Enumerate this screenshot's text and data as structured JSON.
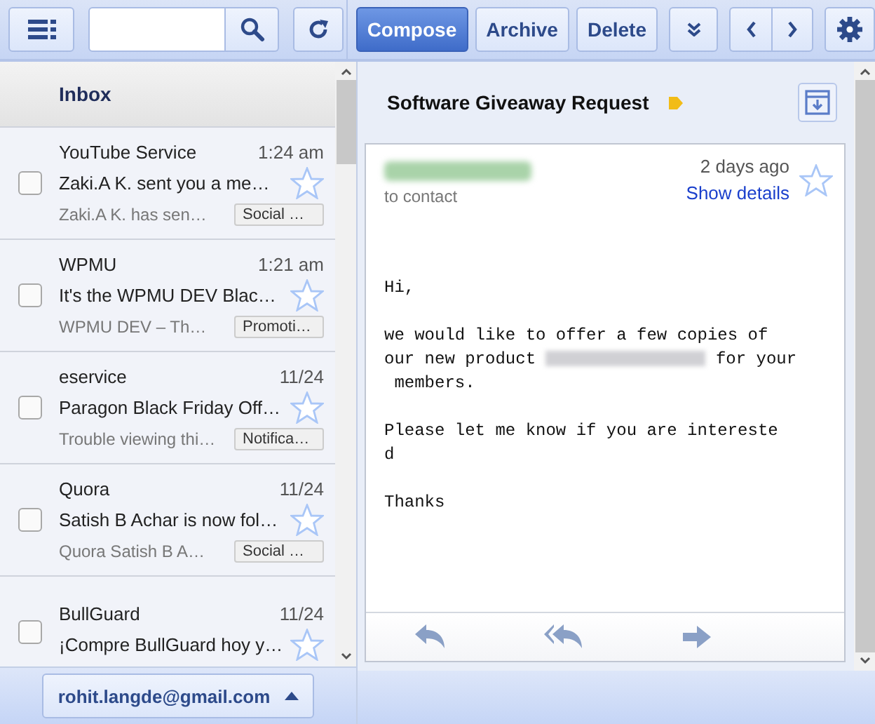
{
  "toolbar": {
    "actions": [
      {
        "label": "Compose",
        "primary": true
      },
      {
        "label": "Archive",
        "primary": false
      },
      {
        "label": "Delete",
        "primary": false
      }
    ]
  },
  "folder": {
    "title": "Inbox"
  },
  "messages": [
    {
      "sender": "YouTube Service",
      "time": "1:24 am",
      "subject": "Zaki.A K. sent you a me…",
      "preview": "Zaki.A K. has sen…",
      "tag": "Social …",
      "checked": false,
      "starred": false
    },
    {
      "sender": "WPMU",
      "time": "1:21 am",
      "subject": "It's the WPMU DEV Blac…",
      "preview": "WPMU DEV – Th…",
      "tag": "Promoti…",
      "checked": false,
      "starred": false
    },
    {
      "sender": "eservice",
      "time": "11/24",
      "subject": "Paragon Black Friday Off…",
      "preview": "Trouble viewing thi…",
      "tag": "Notifica…",
      "checked": false,
      "starred": false
    },
    {
      "sender": "Quora",
      "time": "11/24",
      "subject": "Satish B Achar is now fol…",
      "preview": "Quora Satish B A…",
      "tag": "Social …",
      "checked": false,
      "starred": false
    },
    {
      "sender": "BullGuard",
      "time": "11/24",
      "subject": "¡Compre BullGuard hoy y…",
      "checked": false,
      "starred": false
    }
  ],
  "account": {
    "email": "rohit.langde@gmail.com"
  },
  "thread": {
    "subject": "Software Giveaway Request",
    "important": true,
    "message": {
      "recipient": "to contact",
      "date": "2 days ago",
      "details_link": "Show details",
      "starred": false,
      "body": [
        {
          "kind": "text",
          "text": "Hi,"
        },
        {
          "kind": "blank"
        },
        {
          "kind": "text",
          "text": "we would like to offer a few copies of"
        },
        {
          "kind": "redacted",
          "before": "our new product",
          "after": "for your"
        },
        {
          "kind": "text",
          "text": " members."
        },
        {
          "kind": "blank"
        },
        {
          "kind": "text",
          "text": "Please let me know if you are intereste"
        },
        {
          "kind": "text",
          "text": "d"
        },
        {
          "kind": "blank"
        },
        {
          "kind": "text",
          "text": "Thanks"
        }
      ]
    }
  }
}
